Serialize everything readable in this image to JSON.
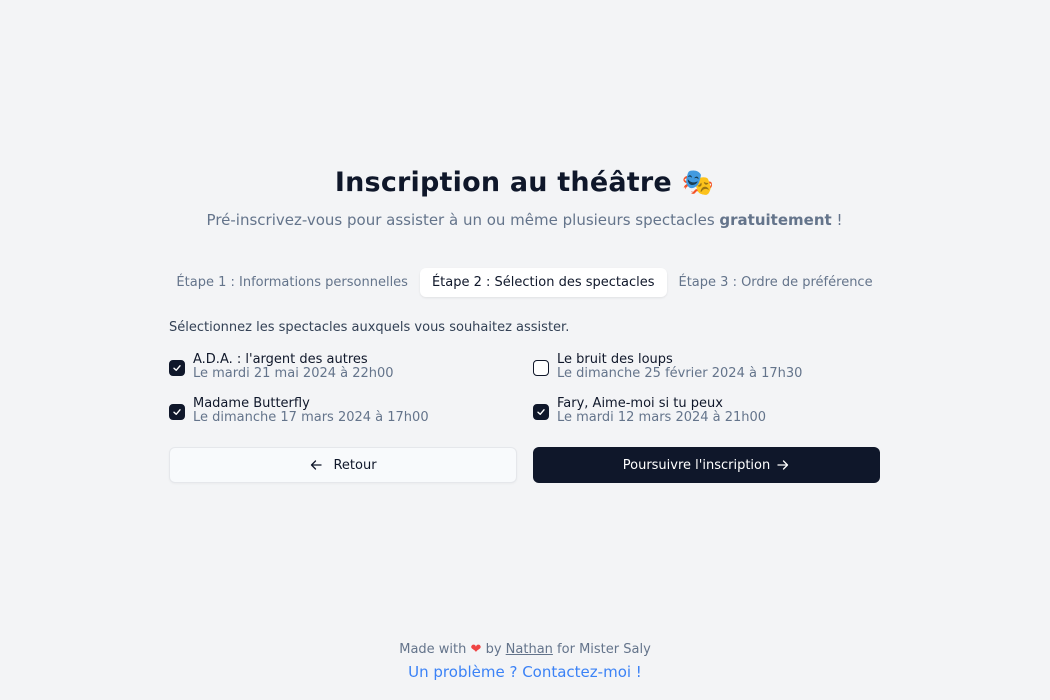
{
  "header": {
    "title": "Inscription au théâtre",
    "title_emoji": "🎭",
    "subtitle_prefix": "Pré-inscrivez-vous pour assister à un ou même plusieurs spectacles",
    "subtitle_bold": "gratuitement",
    "subtitle_suffix": "!"
  },
  "tabs": [
    {
      "label": "Étape 1 : Informations personnelles",
      "active": false
    },
    {
      "label": "Étape 2 : Sélection des spectacles",
      "active": true
    },
    {
      "label": "Étape 3 : Ordre de préférence",
      "active": false
    }
  ],
  "instruction": "Sélectionnez les spectacles auxquels vous souhaitez assister.",
  "shows": [
    {
      "name": "A.D.A. : l'argent des autres",
      "date": "Le mardi 21 mai 2024 à 22h00",
      "checked": true
    },
    {
      "name": "Le bruit des loups",
      "date": "Le dimanche 25 février 2024 à 17h30",
      "checked": false
    },
    {
      "name": "Madame Butterfly",
      "date": "Le dimanche 17 mars 2024 à 17h00",
      "checked": true
    },
    {
      "name": "Fary, Aime-moi si tu peux",
      "date": "Le mardi 12 mars 2024 à 21h00",
      "checked": true
    }
  ],
  "buttons": {
    "back_label": "Retour",
    "back_icon": "arrow-left-icon",
    "next_label": "Poursuivre l'inscription",
    "next_icon": "arrow-right-icon"
  },
  "footer": {
    "made_with": "Made with",
    "heart": "❤",
    "by": "by",
    "author": "Nathan",
    "for": "for",
    "owner": "Mister Saly",
    "contact": "Un problème ? Contactez-moi !"
  },
  "colors": {
    "background": "#f3f4f6",
    "primary": "#0f172a",
    "muted": "#64748b",
    "link": "#3b82f6",
    "heart": "#ef4444"
  }
}
